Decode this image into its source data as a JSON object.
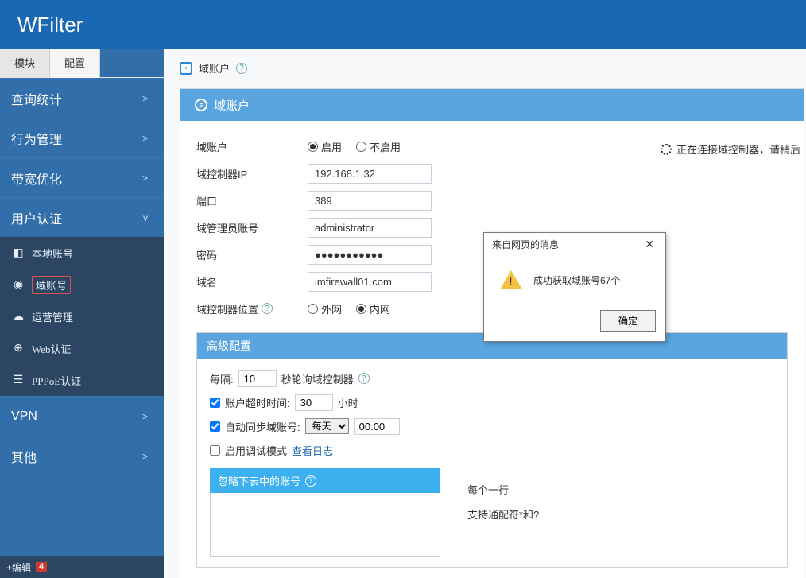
{
  "brand": "WFilter",
  "sidebar": {
    "tabs": {
      "module": "模块",
      "config": "配置"
    },
    "cats": {
      "query": "查询统计",
      "behavior": "行为管理",
      "bandwidth": "带宽优化",
      "userauth": "用户认证",
      "vpn": "VPN",
      "other": "其他"
    },
    "userauth_items": [
      {
        "icon": "◧",
        "label": "本地账号"
      },
      {
        "icon": "◉",
        "label": "域账号"
      },
      {
        "icon": "☁",
        "label": "运营管理"
      },
      {
        "icon": "⊕",
        "label": "Web认证"
      },
      {
        "icon": "☰",
        "label": "PPPoE认证"
      }
    ],
    "chev_right": ">",
    "chev_down": "v"
  },
  "footer": {
    "edit_label": "+编辑",
    "badge": "4"
  },
  "crumb": {
    "title": "域账户"
  },
  "panel": {
    "title": "域账户",
    "rows": {
      "account_lbl": "域账户",
      "enable": "启用",
      "disable": "不启用",
      "ctrl_ip_lbl": "域控制器IP",
      "ctrl_ip_val": "192.168.1.32",
      "port_lbl": "端口",
      "port_val": "389",
      "admin_lbl": "域管理员账号",
      "admin_val": "administrator",
      "pwd_lbl": "密码",
      "pwd_val": "●●●●●●●●●●●",
      "domain_lbl": "域名",
      "domain_val": "imfirewall01.com",
      "loc_lbl": "域控制器位置",
      "loc_ext": "外网",
      "loc_int": "内网"
    },
    "status": "正在连接域控制器，请稍后"
  },
  "adv": {
    "title": "高级配置",
    "interval_pre": "每隔:",
    "interval_val": "10",
    "interval_post": "秒轮询域控制器",
    "timeout_lbl": "账户超时时间:",
    "timeout_val": "30",
    "timeout_unit": "小时",
    "sync_lbl": "自动同步域账号:",
    "sync_sel": "每天",
    "sync_time": "00:00",
    "debug_lbl": "启用调试模式",
    "view_log": "查看日志",
    "ignore_title": "忽略下表中的账号",
    "hint1": "每个一行",
    "hint2": "支持通配符*和?"
  },
  "modal": {
    "title": "来自网页的消息",
    "msg": "成功获取域账号67个",
    "ok": "确定"
  }
}
